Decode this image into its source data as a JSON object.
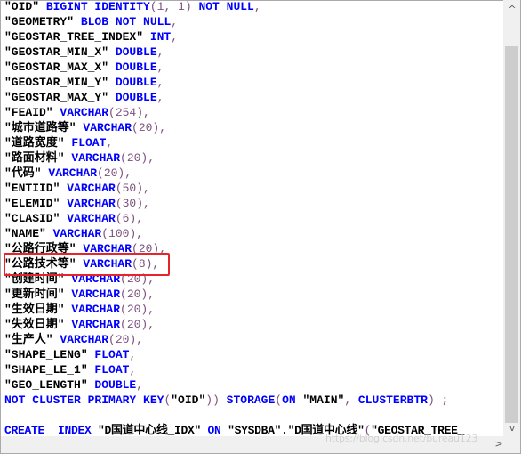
{
  "colors": {
    "keyword": "#0000ff",
    "string": "#000000",
    "punct": "#7d4f7d",
    "highlight_box": "#e8242b"
  },
  "lines": [
    [
      [
        "\"OID\" ",
        "s"
      ],
      [
        "BIGINT IDENTITY",
        "k"
      ],
      [
        "(1, 1) ",
        "p"
      ],
      [
        "NOT NULL",
        "k"
      ],
      [
        ",",
        "p"
      ]
    ],
    [
      [
        "\"GEOMETRY\" ",
        "s"
      ],
      [
        "BLOB NOT NULL",
        "k"
      ],
      [
        ",",
        "p"
      ]
    ],
    [
      [
        "\"GEOSTAR_TREE_INDEX\" ",
        "s"
      ],
      [
        "INT",
        "k"
      ],
      [
        ",",
        "p"
      ]
    ],
    [
      [
        "\"GEOSTAR_MIN_X\" ",
        "s"
      ],
      [
        "DOUBLE",
        "k"
      ],
      [
        ",",
        "p"
      ]
    ],
    [
      [
        "\"GEOSTAR_MAX_X\" ",
        "s"
      ],
      [
        "DOUBLE",
        "k"
      ],
      [
        ",",
        "p"
      ]
    ],
    [
      [
        "\"GEOSTAR_MIN_Y\" ",
        "s"
      ],
      [
        "DOUBLE",
        "k"
      ],
      [
        ",",
        "p"
      ]
    ],
    [
      [
        "\"GEOSTAR_MAX_Y\" ",
        "s"
      ],
      [
        "DOUBLE",
        "k"
      ],
      [
        ",",
        "p"
      ]
    ],
    [
      [
        "\"FEAID\" ",
        "s"
      ],
      [
        "VARCHAR",
        "k"
      ],
      [
        "(254),",
        "p"
      ]
    ],
    [
      [
        "\"城市道路等\" ",
        "s"
      ],
      [
        "VARCHAR",
        "k"
      ],
      [
        "(20),",
        "p"
      ]
    ],
    [
      [
        "\"道路宽度\" ",
        "s"
      ],
      [
        "FLOAT",
        "k"
      ],
      [
        ",",
        "p"
      ]
    ],
    [
      [
        "\"路面材料\" ",
        "s"
      ],
      [
        "VARCHAR",
        "k"
      ],
      [
        "(20),",
        "p"
      ]
    ],
    [
      [
        "\"代码\" ",
        "s"
      ],
      [
        "VARCHAR",
        "k"
      ],
      [
        "(20),",
        "p"
      ]
    ],
    [
      [
        "\"ENTIID\" ",
        "s"
      ],
      [
        "VARCHAR",
        "k"
      ],
      [
        "(50),",
        "p"
      ]
    ],
    [
      [
        "\"ELEMID\" ",
        "s"
      ],
      [
        "VARCHAR",
        "k"
      ],
      [
        "(30),",
        "p"
      ]
    ],
    [
      [
        "\"CLASID\" ",
        "s"
      ],
      [
        "VARCHAR",
        "k"
      ],
      [
        "(6),",
        "p"
      ]
    ],
    [
      [
        "\"NAME\" ",
        "s"
      ],
      [
        "VARCHAR",
        "k"
      ],
      [
        "(100),",
        "p"
      ]
    ],
    [
      [
        "\"公路行政等\" ",
        "s"
      ],
      [
        "VARCHAR",
        "k"
      ],
      [
        "(20),",
        "p"
      ]
    ],
    [
      [
        "\"公路技术等\" ",
        "s"
      ],
      [
        "VARCHAR",
        "k"
      ],
      [
        "(8),",
        "p"
      ]
    ],
    [
      [
        "\"创建时间\" ",
        "s"
      ],
      [
        "VARCHAR",
        "k"
      ],
      [
        "(20),",
        "p"
      ]
    ],
    [
      [
        "\"更新时间\" ",
        "s"
      ],
      [
        "VARCHAR",
        "k"
      ],
      [
        "(20),",
        "p"
      ]
    ],
    [
      [
        "\"生效日期\" ",
        "s"
      ],
      [
        "VARCHAR",
        "k"
      ],
      [
        "(20),",
        "p"
      ]
    ],
    [
      [
        "\"失效日期\" ",
        "s"
      ],
      [
        "VARCHAR",
        "k"
      ],
      [
        "(20),",
        "p"
      ]
    ],
    [
      [
        "\"生产人\" ",
        "s"
      ],
      [
        "VARCHAR",
        "k"
      ],
      [
        "(20),",
        "p"
      ]
    ],
    [
      [
        "\"SHAPE_LENG\" ",
        "s"
      ],
      [
        "FLOAT",
        "k"
      ],
      [
        ",",
        "p"
      ]
    ],
    [
      [
        "\"SHAPE_LE_1\" ",
        "s"
      ],
      [
        "FLOAT",
        "k"
      ],
      [
        ",",
        "p"
      ]
    ],
    [
      [
        "\"GEO_LENGTH\" ",
        "s"
      ],
      [
        "DOUBLE",
        "k"
      ],
      [
        ",",
        "p"
      ]
    ],
    [
      [
        "NOT CLUSTER PRIMARY KEY",
        "k"
      ],
      [
        "(",
        "p"
      ],
      [
        "\"OID\"",
        "s"
      ],
      [
        ")) ",
        "p"
      ],
      [
        "STORAGE",
        "k"
      ],
      [
        "(",
        "p"
      ],
      [
        "ON ",
        "k"
      ],
      [
        "\"MAIN\"",
        "s"
      ],
      [
        ", ",
        "p"
      ],
      [
        "CLUSTERBTR",
        "k"
      ],
      [
        ") ;",
        "p"
      ]
    ],
    [],
    [
      [
        "CREATE  INDEX ",
        "k"
      ],
      [
        "\"D国道中心线_IDX\" ",
        "s"
      ],
      [
        "ON ",
        "k"
      ],
      [
        "\"SYSDBA\".\"D国道中心线\"",
        "s"
      ],
      [
        "(",
        "p"
      ],
      [
        "\"GEOSTAR_TREE_",
        "s"
      ]
    ]
  ],
  "watermark": "https://blog.csdn.net/bureau123",
  "scroll": {
    "vertical_up": "^",
    "vertical_down": "v",
    "horizontal_right": ">"
  }
}
